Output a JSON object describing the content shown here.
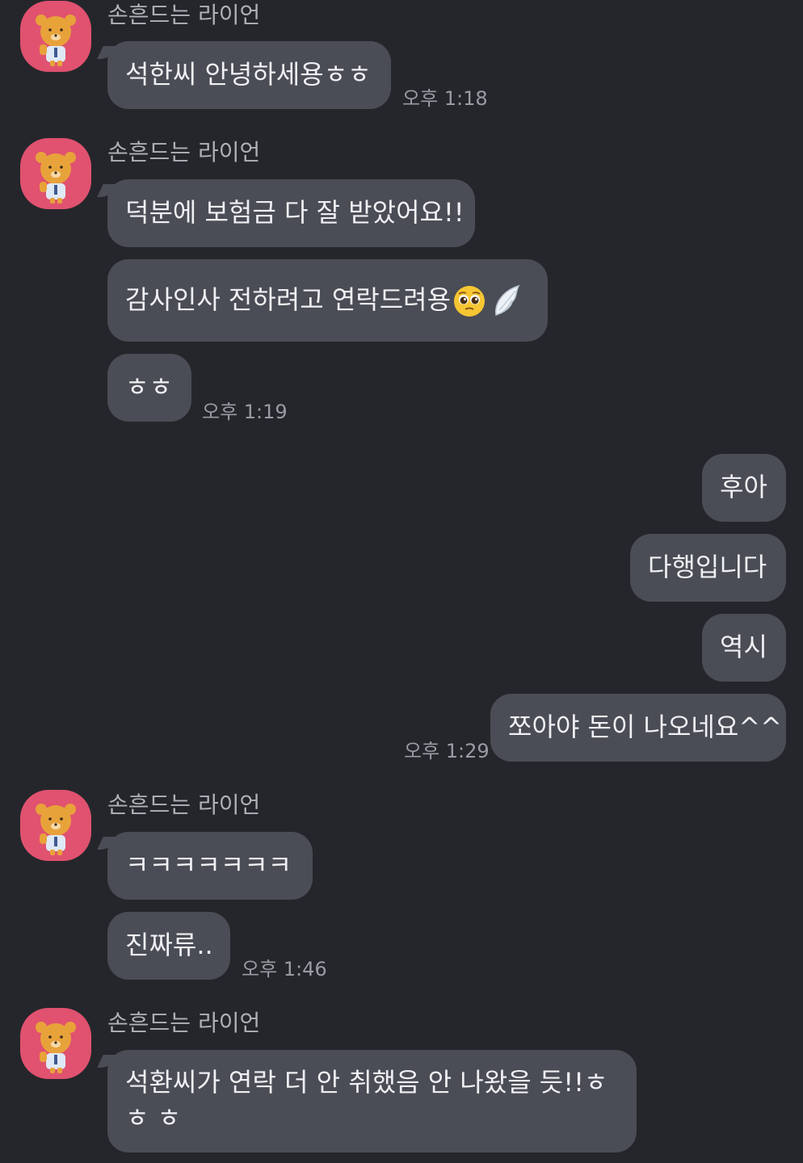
{
  "chat": {
    "groups": [
      {
        "sender": "손흔드는 라이언",
        "messages": [
          {
            "text": "석한씨 안녕하세용ㅎㅎ"
          }
        ],
        "time": "오후 1:18"
      },
      {
        "sender": "손흔드는 라이언",
        "messages": [
          {
            "text": "덕분에 보험금 다 잘 받았어요!!"
          },
          {
            "text": "감사인사 전하려고 연락드려용",
            "emojis": [
              "pleading-face-emoji",
              "angel-wing-emoji"
            ]
          },
          {
            "text": "ㅎㅎ"
          }
        ],
        "time": "오후 1:19"
      },
      {
        "sender": "",
        "outgoing": true,
        "messages": [
          {
            "text": "후아"
          },
          {
            "text": "다행입니다"
          },
          {
            "text": "역시"
          },
          {
            "text": "쪼아야 돈이 나오네요^^"
          }
        ],
        "time": "오후 1:29"
      },
      {
        "sender": "손흔드는 라이언",
        "messages": [
          {
            "text": "ㅋㅋㅋㅋㅋㅋㅋ"
          },
          {
            "text": "진짜류.."
          }
        ],
        "time": "오후 1:46"
      },
      {
        "sender": "손흔드는 라이언",
        "messages": [
          {
            "text": "석환씨가 연락 더 안 취했음 안 나왔을 듯!!ㅎㅎ ㅎ"
          }
        ]
      }
    ]
  },
  "colors": {
    "background": "#25262b",
    "bubble": "#4a4d55",
    "avatar": "#e0526f",
    "text": "#eef0f3",
    "muted": "#9a9ca3"
  },
  "icons": {
    "avatar": "ryan-character-avatar-icon"
  }
}
